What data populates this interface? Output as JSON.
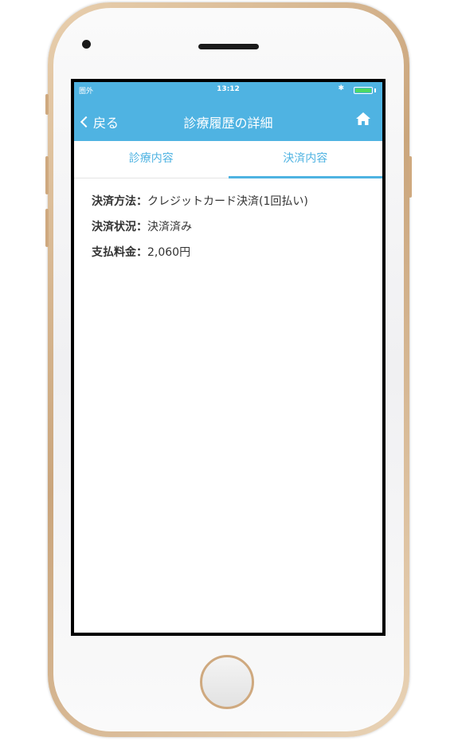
{
  "status_bar": {
    "carrier": "圏外",
    "time": "13:12",
    "bluetooth": "✱",
    "battery_level": 1.0
  },
  "nav": {
    "back_label": "戻る",
    "title": "診療履歴の詳細",
    "home_icon": "home-icon"
  },
  "tabs": [
    {
      "label": "診療内容",
      "active": false
    },
    {
      "label": "決済内容",
      "active": true
    }
  ],
  "payment": {
    "method_label": "決済方法：",
    "method_value": "クレジットカード決済(1回払い)",
    "status_label": "決済状況：",
    "status_value": "決済済み",
    "amount_label": "支払料金：",
    "amount_value": "2,060円"
  },
  "colors": {
    "accent": "#4fb3e2",
    "phone_frame": "#caa57c"
  }
}
